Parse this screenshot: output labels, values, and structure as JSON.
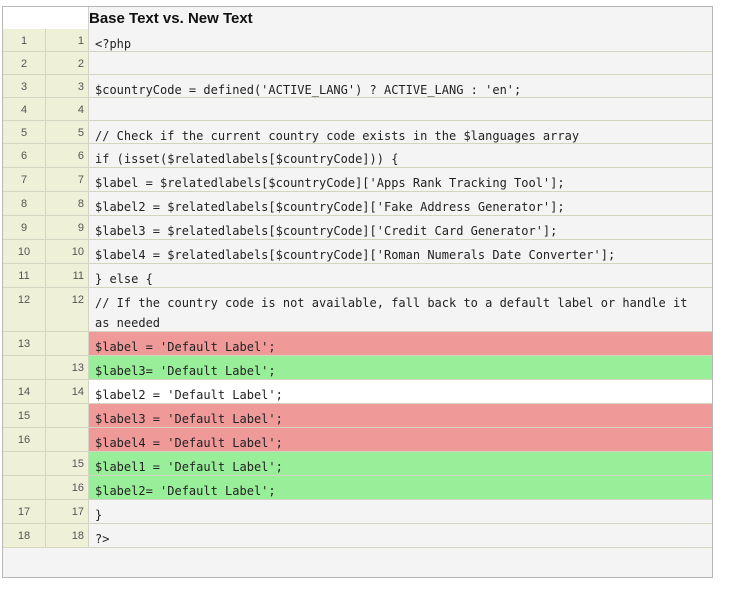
{
  "title": "Base Text vs. New Text",
  "rows": [
    {
      "left": "1",
      "right": "1",
      "kind": "equal",
      "text": "<?php"
    },
    {
      "left": "2",
      "right": "2",
      "kind": "equal",
      "text": ""
    },
    {
      "left": "3",
      "right": "3",
      "kind": "equal",
      "text": "$countryCode = defined('ACTIVE_LANG') ? ACTIVE_LANG : 'en';"
    },
    {
      "left": "4",
      "right": "4",
      "kind": "equal",
      "text": ""
    },
    {
      "left": "5",
      "right": "5",
      "kind": "equal",
      "text": "// Check if the current country code exists in the $languages array"
    },
    {
      "left": "6",
      "right": "6",
      "kind": "equal",
      "text": "if (isset($relatedlabels[$countryCode])) {"
    },
    {
      "left": "7",
      "right": "7",
      "kind": "equal",
      "text": "$label = $relatedlabels[$countryCode]['Apps Rank Tracking Tool'];"
    },
    {
      "left": "8",
      "right": "8",
      "kind": "equal",
      "text": "$label2 = $relatedlabels[$countryCode]['Fake Address Generator'];"
    },
    {
      "left": "9",
      "right": "9",
      "kind": "equal",
      "text": "$label3 = $relatedlabels[$countryCode]['Credit Card Generator'];"
    },
    {
      "left": "10",
      "right": "10",
      "kind": "equal",
      "text": "$label4 = $relatedlabels[$countryCode]['Roman Numerals Date Converter'];"
    },
    {
      "left": "11",
      "right": "11",
      "kind": "equal",
      "text": "} else {"
    },
    {
      "left": "12",
      "right": "12",
      "kind": "equal",
      "text": "// If the country code is not available, fall back to a default label or handle it as needed"
    },
    {
      "left": "13",
      "right": "",
      "kind": "deleted",
      "text": "$label = 'Default Label';"
    },
    {
      "left": "",
      "right": "13",
      "kind": "inserted",
      "text": "$label3= 'Default Label';"
    },
    {
      "left": "14",
      "right": "14",
      "kind": "plain",
      "text": "$label2 = 'Default Label';"
    },
    {
      "left": "15",
      "right": "",
      "kind": "deleted",
      "text": "$label3 = 'Default Label';"
    },
    {
      "left": "16",
      "right": "",
      "kind": "deleted",
      "text": "$label4 = 'Default Label';"
    },
    {
      "left": "",
      "right": "15",
      "kind": "inserted",
      "text": "$label1 = 'Default Label';"
    },
    {
      "left": "",
      "right": "16",
      "kind": "inserted",
      "text": "$label2= 'Default Label';"
    },
    {
      "left": "17",
      "right": "17",
      "kind": "equal",
      "text": "}"
    },
    {
      "left": "18",
      "right": "18",
      "kind": "equal",
      "text": "?>"
    }
  ],
  "colors": {
    "deleted": "#ef9999",
    "inserted": "#99ee99",
    "gutter": "#eef0d8",
    "background": "#f4f4f4"
  }
}
